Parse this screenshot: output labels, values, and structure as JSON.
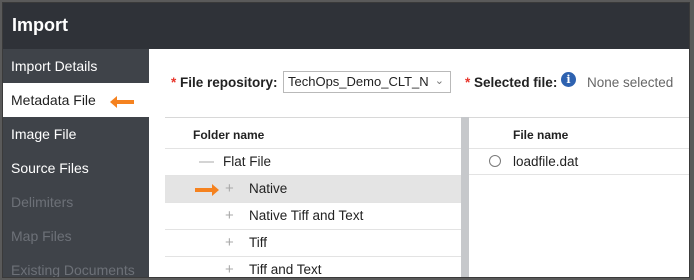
{
  "window": {
    "title": "Import"
  },
  "sidebar": {
    "items": [
      {
        "label": "Import Details",
        "state": "normal"
      },
      {
        "label": "Metadata File",
        "state": "active"
      },
      {
        "label": "Image File",
        "state": "normal"
      },
      {
        "label": "Source Files",
        "state": "normal"
      },
      {
        "label": "Delimiters",
        "state": "disabled"
      },
      {
        "label": "Map Files",
        "state": "disabled"
      },
      {
        "label": "Existing Documents",
        "state": "disabled"
      }
    ]
  },
  "form": {
    "required_marker": "*",
    "file_repository_label": "File repository:",
    "file_repository_value": "TechOps_Demo_CLT_N",
    "selected_file_label": "Selected file:",
    "info_icon": "i",
    "selected_file_value": "None selected"
  },
  "folders": {
    "header": "Folder name",
    "rows": [
      {
        "label": "Flat File",
        "sign": "—"
      },
      {
        "label": "Native",
        "sign": "+"
      },
      {
        "label": "Native Tiff and Text",
        "sign": "+"
      },
      {
        "label": "Tiff",
        "sign": "+"
      },
      {
        "label": "Tiff and Text",
        "sign": "+"
      }
    ]
  },
  "files": {
    "header": "File name",
    "rows": [
      {
        "label": "loadfile.dat"
      }
    ]
  },
  "colors": {
    "titlebar": "#2f3238",
    "sidebar": "#3f4349",
    "arrow": "#f5821f",
    "required": "#e8352b",
    "info": "#2e62b0",
    "selected_row": "#e4e4e4"
  }
}
